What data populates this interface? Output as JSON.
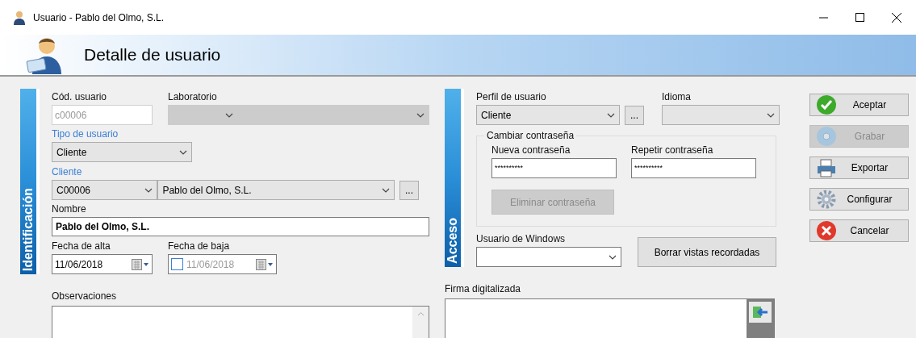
{
  "window": {
    "title": "Usuario - Pablo del Olmo, S.L."
  },
  "header": {
    "title": "Detalle de usuario"
  },
  "identificacion": {
    "tab_label": "Identificación",
    "cod_usuario": {
      "label": "Cód. usuario",
      "value": "c00006",
      "disabled": true
    },
    "laboratorio": {
      "label": "Laboratorio",
      "disabled": true
    },
    "tipo_usuario": {
      "label": "Tipo de usuario",
      "required": true,
      "value": "Cliente"
    },
    "cliente": {
      "label": "Cliente",
      "required": true,
      "code": "C00006",
      "name": "Pablo del Olmo, S.L.",
      "button": "..."
    },
    "nombre": {
      "label": "Nombre",
      "value": "Pablo del Olmo, S.L."
    },
    "fecha_alta": {
      "label": "Fecha de alta",
      "value": "11/06/2018"
    },
    "fecha_baja": {
      "label": "Fecha de baja",
      "value": "11/06/2018",
      "checked": false
    },
    "observaciones": {
      "label": "Observaciones"
    }
  },
  "acceso": {
    "tab_label": "Acceso",
    "perfil": {
      "label": "Perfil de usuario",
      "value": "Cliente",
      "button": "..."
    },
    "idioma": {
      "label": "Idioma"
    },
    "cambiar_contrasena": {
      "legend": "Cambiar contraseña",
      "nueva": {
        "label": "Nueva contraseña",
        "value": "**********"
      },
      "repetir": {
        "label": "Repetir contraseña",
        "value": "**********"
      },
      "eliminar": {
        "label": "Eliminar contraseña",
        "disabled": true
      }
    },
    "usuario_windows": {
      "label": "Usuario de Windows"
    },
    "borrar": {
      "label": "Borrar vistas recordadas"
    }
  },
  "firma": {
    "label": "Firma digitalizada"
  },
  "actions": [
    {
      "kind": "accept",
      "label": "Aceptar",
      "disabled": false
    },
    {
      "kind": "save",
      "label": "Grabar",
      "disabled": true
    },
    {
      "kind": "export",
      "label": "Exportar",
      "disabled": false
    },
    {
      "kind": "configure",
      "label": "Configurar",
      "disabled": false
    },
    {
      "kind": "cancel",
      "label": "Cancelar",
      "disabled": false
    }
  ]
}
